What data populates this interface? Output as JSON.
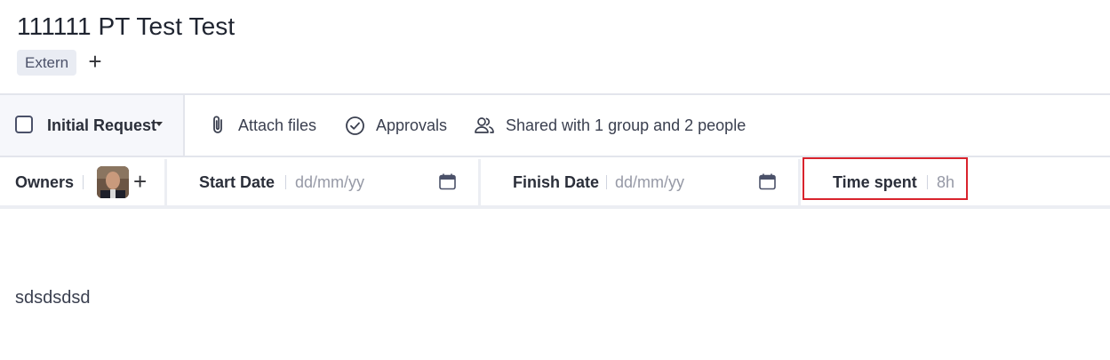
{
  "item": {
    "title": "111111 PT Test Test",
    "tag": "Extern",
    "add_tag_symbol": "+"
  },
  "toolbar": {
    "status_label": "Initial Request",
    "attach_label": "Attach files",
    "approvals_label": "Approvals",
    "shared_label": "Shared with 1 group and 2 people"
  },
  "fields": {
    "owners_label": "Owners",
    "owners_add_symbol": "+",
    "start_label": "Start Date",
    "start_placeholder": "dd/mm/yy",
    "finish_label": "Finish Date",
    "finish_placeholder": "dd/mm/yy",
    "time_label": "Time spent",
    "time_value": "8h"
  },
  "content": {
    "body_text": "sdsdsdsd"
  },
  "colors": {
    "highlight": "#d9232d",
    "toolbar_bg": "#f6f7fb",
    "tag_bg": "#e9ecf3"
  },
  "icons": [
    "paperclip-icon",
    "check-circle-icon",
    "people-icon",
    "calendar-icon",
    "plus-icon",
    "caret-down-icon"
  ]
}
